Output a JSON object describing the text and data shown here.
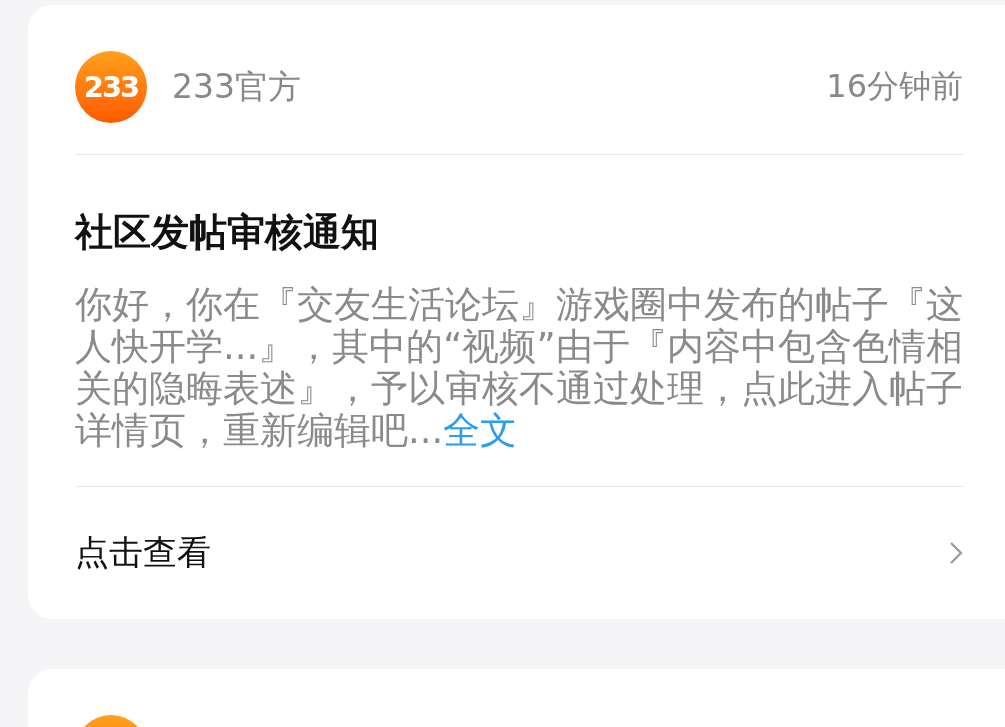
{
  "notifications": [
    {
      "kind": "full",
      "logo_text": "233",
      "sender": "233官方",
      "time": "16分钟前",
      "title": "社区发帖审核通知",
      "body": "你好，你在『交友生活论坛』游戏圈中发布的帖子『这人快开学...』，其中的“视频”由于『内容中包含色情相关的隐晦表述』，予以审核不通过处理，点此进入帖子详情页，重新编辑吧...",
      "more_link": "全文",
      "action": "点击查看"
    },
    {
      "kind": "peek"
    }
  ]
}
